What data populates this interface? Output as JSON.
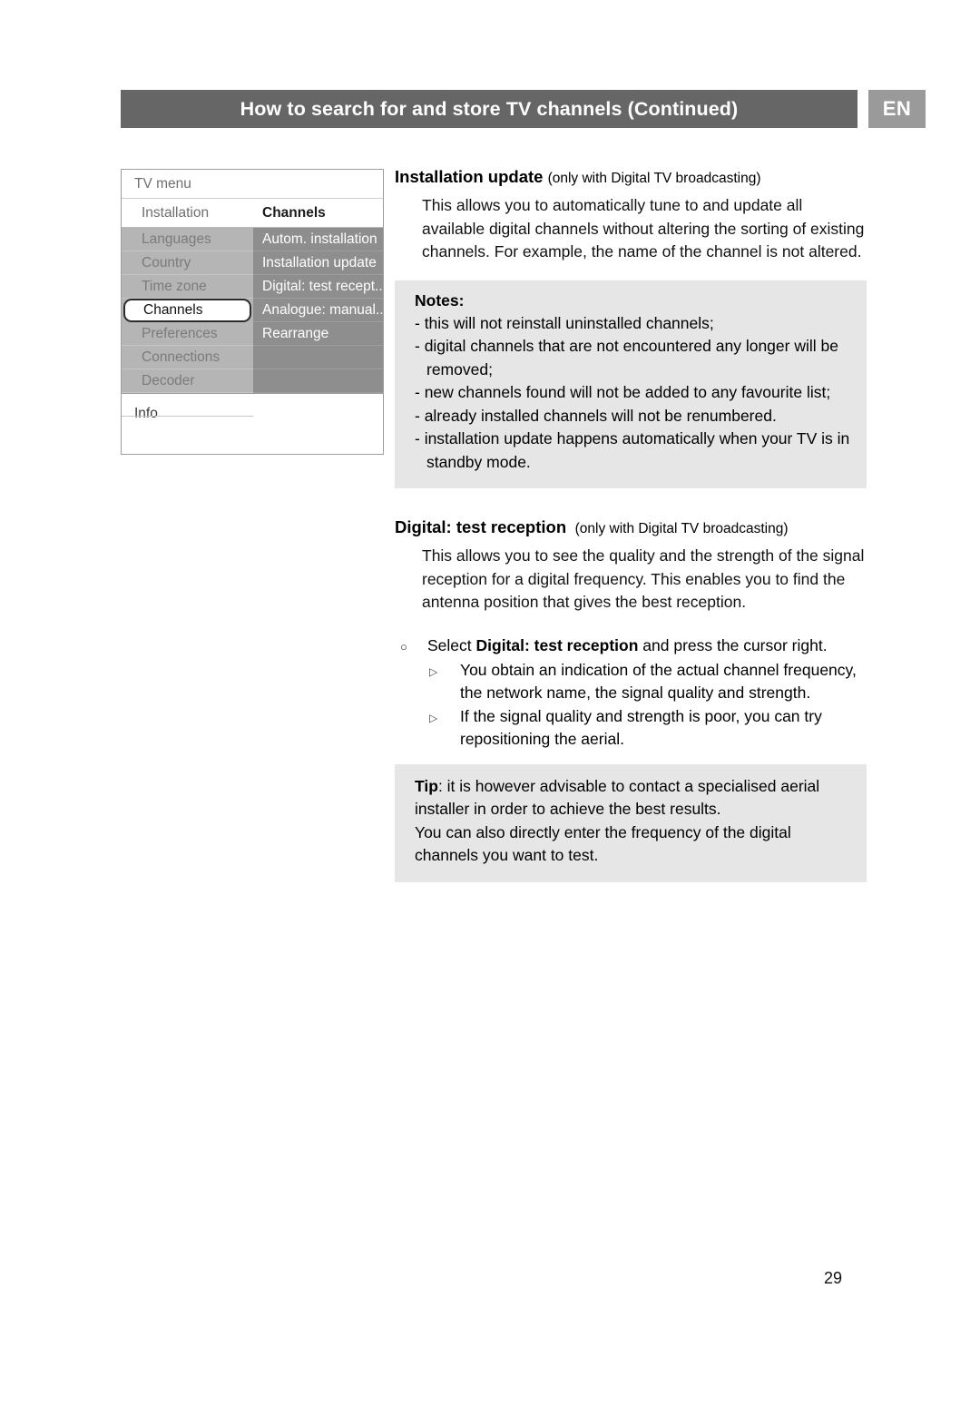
{
  "header": {
    "title": "How to search for and store TV channels  (Continued)",
    "language_badge": "EN"
  },
  "tv_menu": {
    "title": "TV menu",
    "breadcrumb_left": "Installation",
    "breadcrumb_right": "Channels",
    "left_items": [
      "Languages",
      "Country",
      "Time zone",
      "Channels",
      "Preferences",
      "Connections",
      "Decoder",
      "............"
    ],
    "selected_left_item": "Channels",
    "right_items": [
      "Autom. installation",
      "Installation update",
      "Digital: test recept..",
      "Analogue: manual..",
      "Rearrange"
    ],
    "footer": "Info",
    "colors": {
      "left_column": "#b5b5b5",
      "right_column": "#8e8e8e",
      "panel_border": "#9d9d9d"
    }
  },
  "sections": {
    "installation_update": {
      "heading": "Installation update",
      "qualifier": "(only with Digital TV broadcasting)",
      "body": "This allows you to automatically tune to and update all available digital channels without altering the sorting of existing channels. For example, the name of the channel is not altered.",
      "notes_label": "Notes",
      "notes_colon": ":",
      "notes": [
        "- this will not reinstall uninstalled channels;",
        "- digital channels that are not encountered any longer will be removed;",
        "- new channels found will not be added to any favourite list;",
        "- already installed channels will not be renumbered.",
        "- installation update happens automatically when your TV is in standby mode."
      ]
    },
    "digital_test_reception": {
      "heading": "Digital: test reception",
      "qualifier": "(only with Digital TV broadcasting)",
      "body": "This allows you to see the quality and the strength of the signal reception for a digital frequency. This enables you to find the antenna position that gives the best reception.",
      "step_bullet": "○",
      "sub_bullet": "▷",
      "step": {
        "prefix": "Select ",
        "bold": "Digital: test reception",
        "suffix": " and press the cursor right."
      },
      "sub_steps": [
        "You obtain an indication of the actual channel frequency, the network name, the signal quality and strength.",
        "If the signal quality and strength is poor, you can try repositioning the aerial."
      ],
      "tip_label": "Tip",
      "tip_rest": ": it is however advisable to contact a specialised aerial installer in order to achieve the best results.",
      "tip_line2": "You can also directly enter the frequency of the digital channels you want to test."
    }
  },
  "page_number": "29",
  "theme": {
    "header_bar": "#666666",
    "badge_bg": "#9a9a9a",
    "shaded_box": "#e6e6e6"
  }
}
